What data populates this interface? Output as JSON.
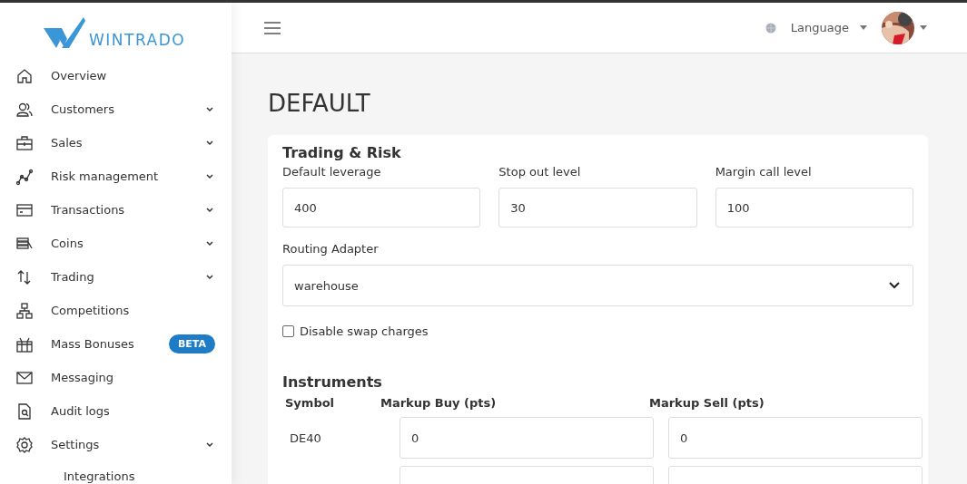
{
  "brand": {
    "name": "WINTRADO"
  },
  "sidebar": {
    "items": [
      {
        "label": "Overview",
        "submenu": false
      },
      {
        "label": "Customers",
        "submenu": true
      },
      {
        "label": "Sales",
        "submenu": true
      },
      {
        "label": "Risk management",
        "submenu": true
      },
      {
        "label": "Transactions",
        "submenu": true
      },
      {
        "label": "Coins",
        "submenu": true
      },
      {
        "label": "Trading",
        "submenu": true
      },
      {
        "label": "Competitions",
        "submenu": false
      },
      {
        "label": "Mass Bonuses",
        "submenu": false,
        "badge": "BETA"
      },
      {
        "label": "Messaging",
        "submenu": false
      },
      {
        "label": "Audit logs",
        "submenu": false
      },
      {
        "label": "Settings",
        "submenu": true,
        "children": [
          {
            "label": "Integrations"
          }
        ]
      }
    ]
  },
  "topbar": {
    "language": "Language"
  },
  "page": {
    "title": "DEFAULT"
  },
  "trading_risk": {
    "title": "Trading & Risk",
    "fields": [
      {
        "label": "Default leverage",
        "value": "400"
      },
      {
        "label": "Stop out level",
        "value": "30"
      },
      {
        "label": "Margin call level",
        "value": "100"
      }
    ],
    "routing": {
      "label": "Routing Adapter",
      "value": "warehouse"
    },
    "swap": {
      "label": "Disable swap charges",
      "checked": false
    }
  },
  "instruments": {
    "title": "Instruments",
    "columns": [
      "Symbol",
      "Markup Buy (pts)",
      "Markup Sell (pts)"
    ],
    "rows": [
      {
        "symbol": "DE40",
        "buy": "0",
        "sell": "0"
      }
    ]
  }
}
